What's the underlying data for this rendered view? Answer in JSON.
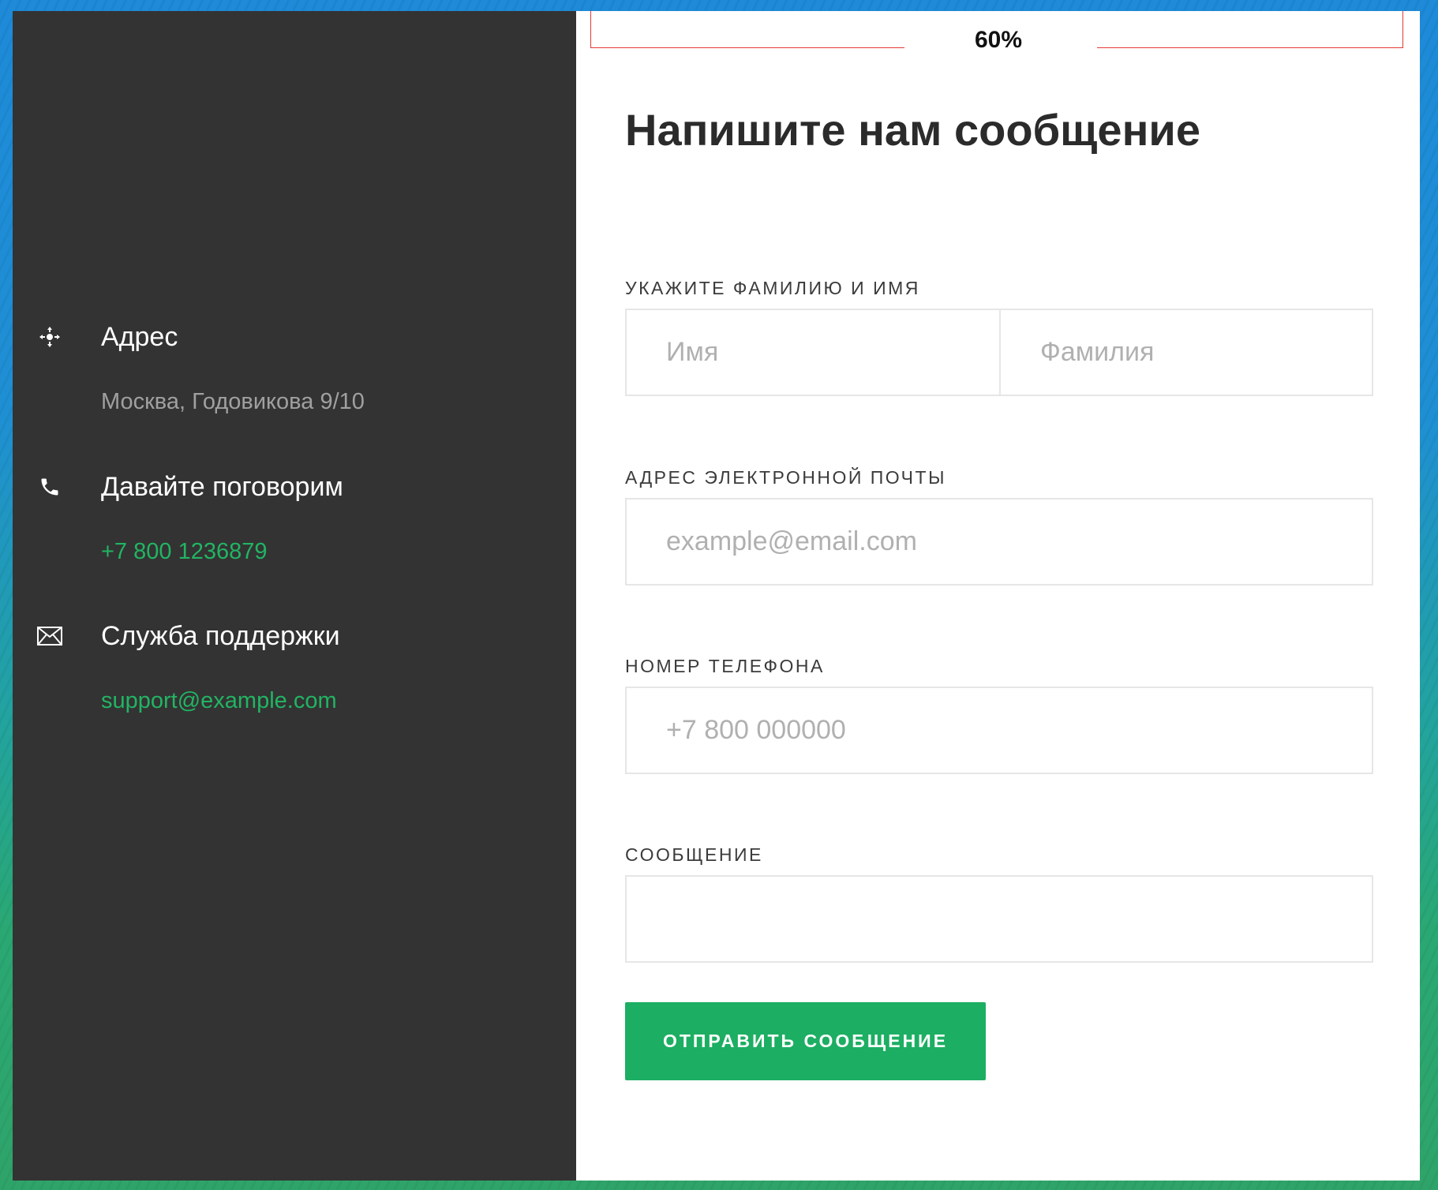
{
  "progress": {
    "label": "60%"
  },
  "sidebar": {
    "address": {
      "icon": "crosshair-move-icon",
      "title": "Адрес",
      "value": "Москва, Годовикова 9/10"
    },
    "phone": {
      "icon": "phone-icon",
      "title": "Давайте поговорим",
      "value": "+7 800 1236879"
    },
    "support": {
      "icon": "envelope-icon",
      "title": "Служба поддержки",
      "value": "support@example.com"
    }
  },
  "form": {
    "heading": "Напишите нам сообщение",
    "name_label": "УКАЖИТЕ ФАМИЛИЮ И ИМЯ",
    "first_name_placeholder": "Имя",
    "last_name_placeholder": "Фамилия",
    "email_label": "АДРЕС ЭЛЕКТРОННОЙ ПОЧТЫ",
    "email_placeholder": "example@email.com",
    "phone_label": "НОМЕР ТЕЛЕФОНА",
    "phone_placeholder": "+7 800 000000",
    "message_label": "СООБЩЕНИЕ",
    "message_placeholder": "",
    "submit_label": "ОТПРАВИТЬ СООБЩЕНИЕ"
  },
  "colors": {
    "sidebar_bg": "#333333",
    "accent_green": "#1cae62",
    "link_green": "#22b463",
    "marker_red": "#e53935"
  }
}
